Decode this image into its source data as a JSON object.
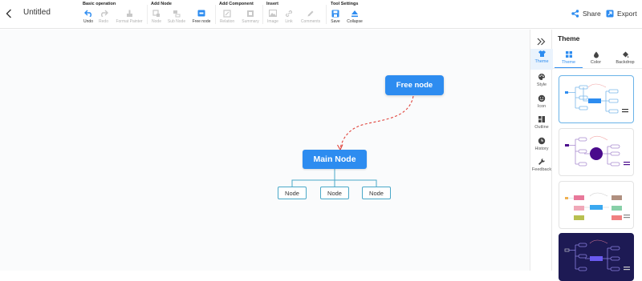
{
  "app": {
    "title": "Untitled"
  },
  "toolbar": {
    "groups": {
      "basic": "Basic operation",
      "add_node": "Add Node",
      "add_component": "Add Component",
      "insert": "Insert",
      "tool_settings": "Tool Settings"
    },
    "tools": {
      "undo": "Undo",
      "redo": "Redo",
      "format_painter": "Format Painter",
      "node": "Node",
      "sub_node": "Sub Node",
      "free_node": "Free node",
      "relation": "Relation",
      "summary": "Summary",
      "image": "Image",
      "link": "Link",
      "comments": "Comments",
      "save": "Save",
      "collapse": "Collapse"
    },
    "share": "Share",
    "export": "Export",
    "colors": {
      "active_icon": "#2d8cf0",
      "disabled_icon": "#c8c8c8"
    }
  },
  "canvas": {
    "main_node": "Main Node",
    "free_node": "Free node",
    "sub_nodes": [
      "Node",
      "Node",
      "Node"
    ],
    "colors": {
      "node_fill": "#2d8cf0",
      "branch_line": "#4aa8c8",
      "relation_line": "#e0443c"
    }
  },
  "rail": {
    "items": [
      {
        "label": "Theme",
        "icon": "shirt-icon"
      },
      {
        "label": "Style",
        "icon": "palette-icon"
      },
      {
        "label": "Icon",
        "icon": "smiley-icon"
      },
      {
        "label": "Outline",
        "icon": "outline-icon"
      },
      {
        "label": "History",
        "icon": "clock-icon"
      },
      {
        "label": "Feedback",
        "icon": "wrench-icon"
      }
    ]
  },
  "panel": {
    "title": "Theme",
    "tabs": [
      "Theme",
      "Color",
      "Backdrop"
    ]
  }
}
